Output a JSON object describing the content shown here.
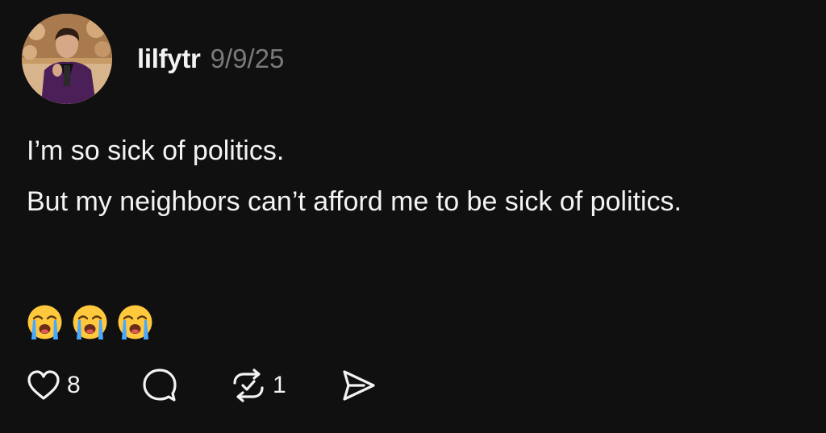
{
  "post": {
    "username": "lilfytr",
    "timestamp": "9/9/25",
    "paragraphs": [
      "I’m so sick of politics.",
      "But my neighbors can’t afford me to be sick of politics."
    ],
    "emojis": [
      "😭",
      "😭",
      "😭"
    ],
    "emoji_icon": "loudly-crying-face-icon"
  },
  "actions": {
    "like_count": "8",
    "repost_count": "1",
    "icons": [
      "heart-icon",
      "comment-bubble-icon",
      "repost-icon",
      "share-send-icon"
    ]
  },
  "colors": {
    "background": "#101010",
    "text": "#f3f3f3",
    "muted": "#7a7a7a",
    "emoji_face": "#ffc83d",
    "emoji_tears": "#4aa8ff"
  }
}
